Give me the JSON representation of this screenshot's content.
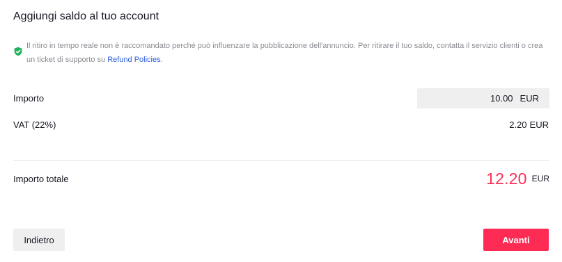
{
  "title": "Aggiungi saldo al tuo account",
  "notice": {
    "icon": "shield-check-icon",
    "icon_color": "#20b25a",
    "text": "Il ritiro in tempo reale non è raccomandato perché può influenzare la pubblicazione dell'annuncio. Per ritirare il tuo saldo, contatta il servizio clienti o crea un ticket di supporto su ",
    "link": "Refund Policies",
    "suffix": "."
  },
  "amount": {
    "label": "Importo",
    "value": "10.00",
    "currency": "EUR"
  },
  "vat": {
    "label": "VAT (22%)",
    "value": "2.20",
    "currency": "EUR"
  },
  "total": {
    "label": "Importo totale",
    "value": "12.20",
    "currency": "EUR",
    "color": "#fe2c55"
  },
  "buttons": {
    "back": "Indietro",
    "next": "Avanti"
  }
}
